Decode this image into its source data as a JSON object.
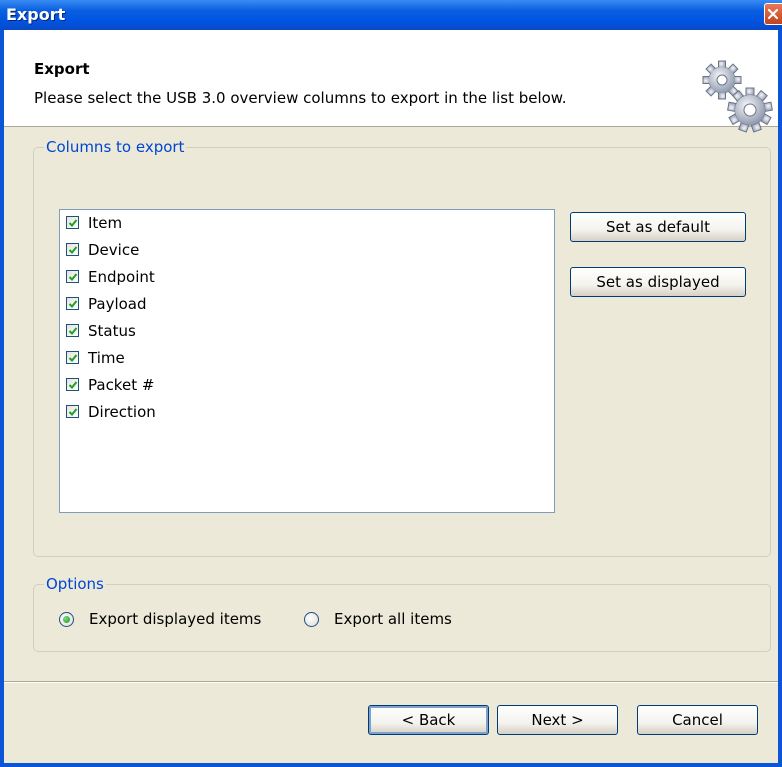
{
  "window": {
    "title": "Export"
  },
  "header": {
    "title": "Export",
    "subtitle": "Please select the USB 3.0 overview columns to export in the list below."
  },
  "columns_group": {
    "legend": "Columns to export",
    "items": [
      {
        "label": "Item",
        "checked": true
      },
      {
        "label": "Device",
        "checked": true
      },
      {
        "label": "Endpoint",
        "checked": true
      },
      {
        "label": "Payload",
        "checked": true
      },
      {
        "label": "Status",
        "checked": true
      },
      {
        "label": "Time",
        "checked": true
      },
      {
        "label": "Packet #",
        "checked": true
      },
      {
        "label": "Direction",
        "checked": true
      }
    ],
    "set_default_label": "Set as default",
    "set_displayed_label": "Set as displayed"
  },
  "options_group": {
    "legend": "Options",
    "export_displayed_label": "Export displayed items",
    "export_all_label": "Export all items",
    "selected": "export_displayed"
  },
  "footer": {
    "back_label": "< Back",
    "next_label": "Next >",
    "cancel_label": "Cancel"
  },
  "colors": {
    "title_bar": "#0054e3",
    "legend_text": "#0046d5",
    "check_mark": "#21a121"
  }
}
